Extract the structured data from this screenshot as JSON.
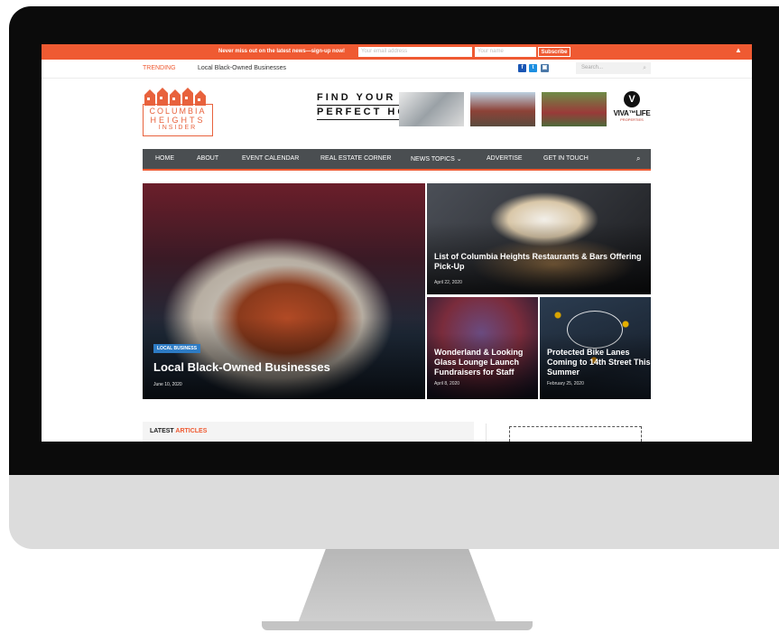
{
  "promo": {
    "text": "Never miss out on the latest news—sign-up now!",
    "email_placeholder": "Your email address",
    "name_placeholder": "Your name",
    "subscribe_label": "Subscribe",
    "scroll_top_glyph": "▲"
  },
  "trending": {
    "label": "TRENDING",
    "item": "Local Black-Owned Businesses",
    "social": {
      "facebook": "f",
      "twitter": "t",
      "instagram": "▣"
    },
    "search_placeholder": "Search...",
    "search_glyph": "⌕"
  },
  "logo": {
    "line1": "COLUMBIA",
    "line2": "HEIGHTS",
    "line3": "INSIDER"
  },
  "ad": {
    "line1": "FIND YOUR",
    "line2": "PERFECT HOME",
    "brand_mark": "V",
    "brand_name": "VIVA™LIFE",
    "brand_sub": "PROPERTIES"
  },
  "nav": {
    "items": [
      "HOME",
      "ABOUT",
      "EVENT CALENDAR",
      "REAL ESTATE CORNER",
      "NEWS TOPICS ⌄",
      "ADVERTISE",
      "GET IN TOUCH"
    ],
    "search_glyph": "⌕"
  },
  "hero": {
    "tag": "LOCAL BUSINESS",
    "title": "Local Black-Owned Businesses",
    "date": "June 10, 2020"
  },
  "cards": [
    {
      "title": "List of Columbia Heights Restaurants & Bars Offering Pick-Up",
      "date": "April 22, 2020"
    },
    {
      "title": "Wonderland & Looking Glass Lounge Launch Fundraisers for Staff",
      "date": "April 8, 2020"
    },
    {
      "title": "Protected Bike Lanes Coming to 14th Street This Summer",
      "date": "February 25, 2020"
    }
  ],
  "latest": {
    "word1": "LATEST",
    "word2": "ARTICLES"
  },
  "colors": {
    "accent": "#ef5a32",
    "nav": "#4a4e51",
    "tag": "#2d7bc4"
  }
}
